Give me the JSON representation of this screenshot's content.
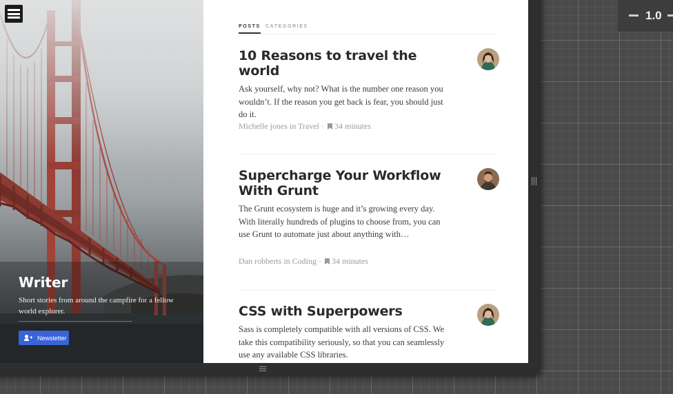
{
  "sidebar": {
    "title": "Writer",
    "description": "Short stories from around the campfire for a fellow world explorer.",
    "newsletter_label": "Newsletter"
  },
  "tabs": [
    "POSTS",
    "CATEGORIES"
  ],
  "posts": [
    {
      "title": "10 Reasons to travel the world",
      "excerpt": "Ask yourself, why not? What is the number one reason you wouldn’t. If the reason you get back is fear, you should just do it.",
      "author": "Michelle jones",
      "category": "Travel",
      "read_time": "34 minutes",
      "avatar": "avatar-woman"
    },
    {
      "title": "Supercharge Your Workflow With Grunt",
      "excerpt": "The Grunt ecosystem is huge and it’s growing every day. With literally hundreds of plugins to choose from, you can use Grunt to automate just about anything with…",
      "author": "Dan robberts",
      "category": "Coding",
      "read_time": "34 minutes",
      "avatar": "avatar-man"
    },
    {
      "title": "CSS with Superpowers",
      "excerpt": "Sass is completely compatible with all versions of CSS. We take this compatibility seriously, so that you can seamlessly use any available CSS libraries.",
      "avatar": "avatar-woman"
    }
  ],
  "zoom": {
    "value": "1.0"
  },
  "colors": {
    "accent": "#3a63d8",
    "text": "#2a2a2a",
    "meta": "#9a9a9a"
  }
}
